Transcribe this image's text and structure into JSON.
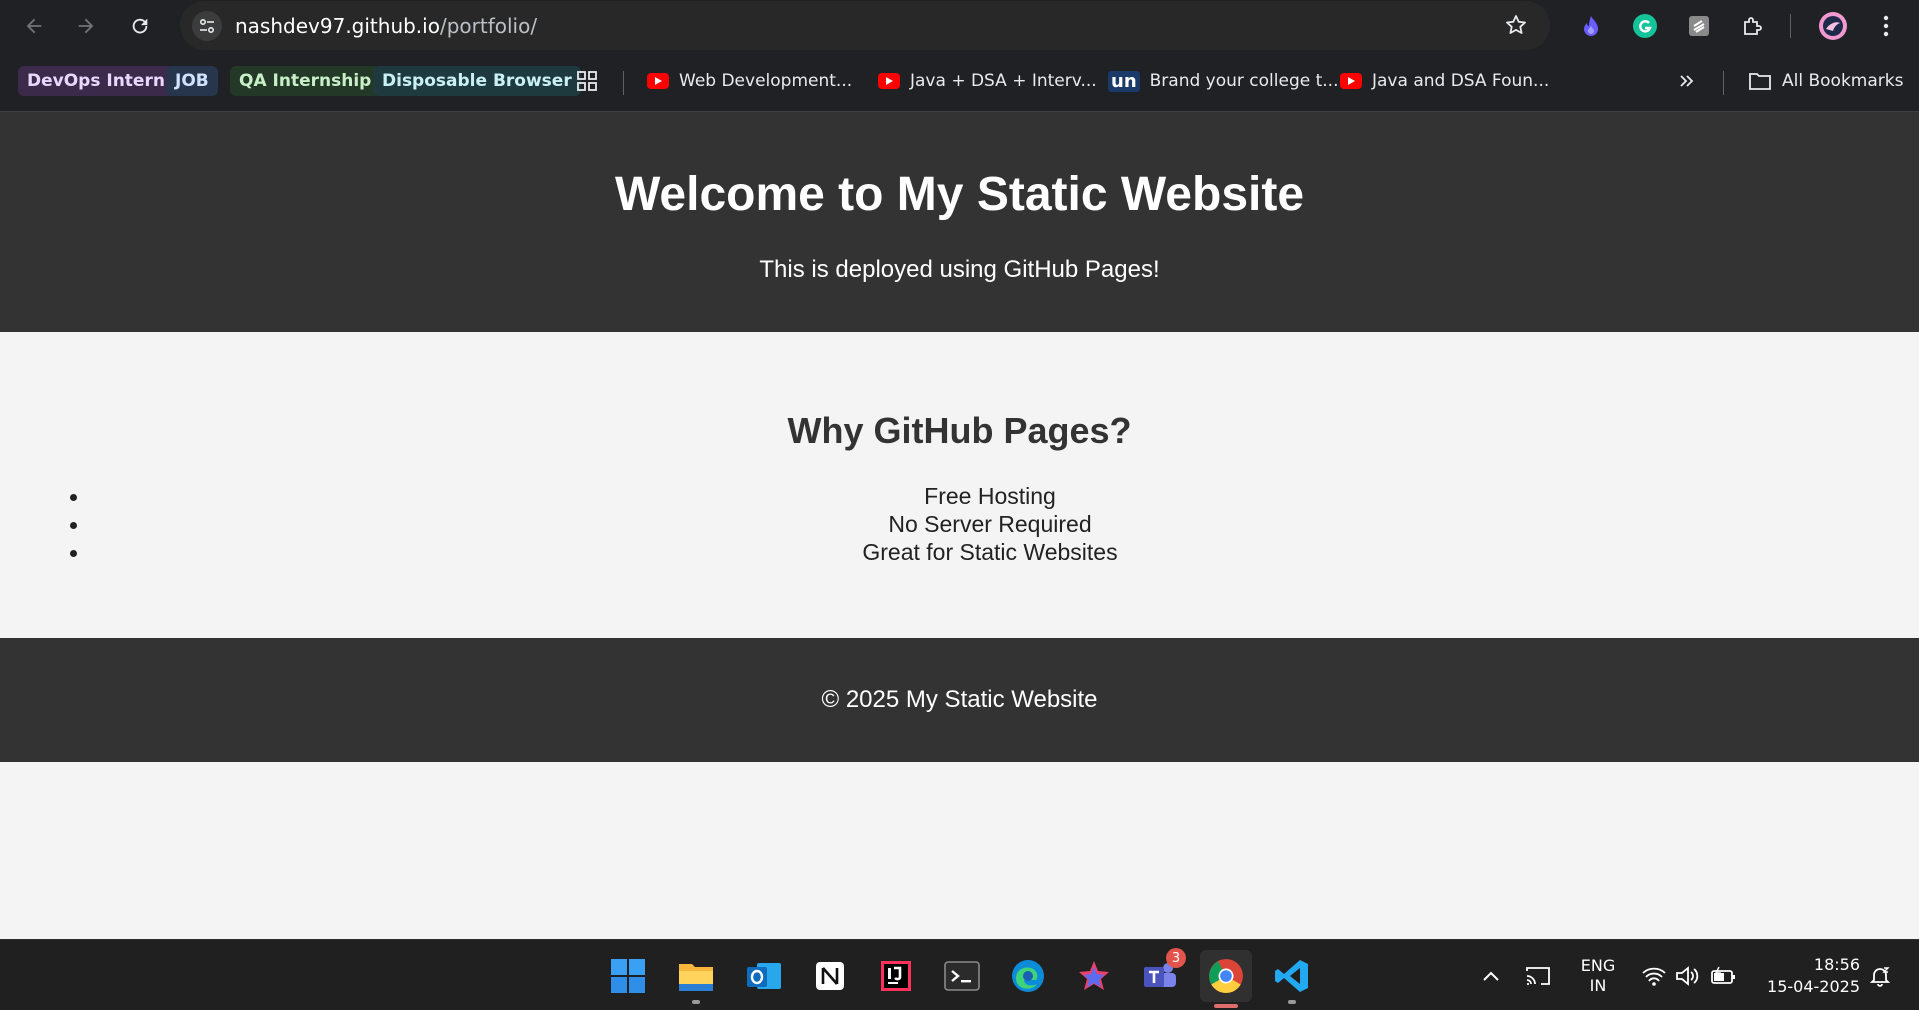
{
  "browser": {
    "url_host": "nashdev97.github.io",
    "url_path": "/portfolio/",
    "bookmarks": [
      {
        "label": "DevOps Intern",
        "style": "chip"
      },
      {
        "label": "JOB",
        "style": "chip"
      },
      {
        "label": "QA Internship",
        "style": "chip"
      },
      {
        "label": "Disposable  Browser",
        "style": "chip"
      },
      {
        "label": "Web Development...",
        "icon": "youtube-icon"
      },
      {
        "label": "Java + DSA + Interv...",
        "icon": "youtube-icon"
      },
      {
        "label": "Brand your college t...",
        "icon": "un-logo-icon",
        "icon_text": "un"
      },
      {
        "label": "Java and DSA Foun...",
        "icon": "youtube-icon"
      }
    ],
    "all_bookmarks_label": "All Bookmarks"
  },
  "page": {
    "header_title": "Welcome to My Static Website",
    "header_subtitle": "This is deployed using GitHub Pages!",
    "section_title": "Why GitHub Pages?",
    "features": [
      "Free Hosting",
      "No Server Required",
      "Great for Static Websites"
    ],
    "footer_text": "© 2025 My Static Website"
  },
  "taskbar": {
    "apps": [
      "start-icon",
      "file-explorer-icon",
      "outlook-icon",
      "notion-icon",
      "intellij-icon",
      "terminal-icon",
      "edge-icon",
      "app-icon",
      "teams-icon",
      "chrome-icon",
      "vscode-icon"
    ],
    "teams_badge": "3",
    "lang_line1": "ENG",
    "lang_line2": "IN",
    "time": "18:56",
    "date": "15-04-2025"
  },
  "colors": {
    "header_bg": "#333333",
    "page_bg": "#f4f4f4",
    "browser_bg": "#202124",
    "taskbar_bg": "#202020"
  }
}
